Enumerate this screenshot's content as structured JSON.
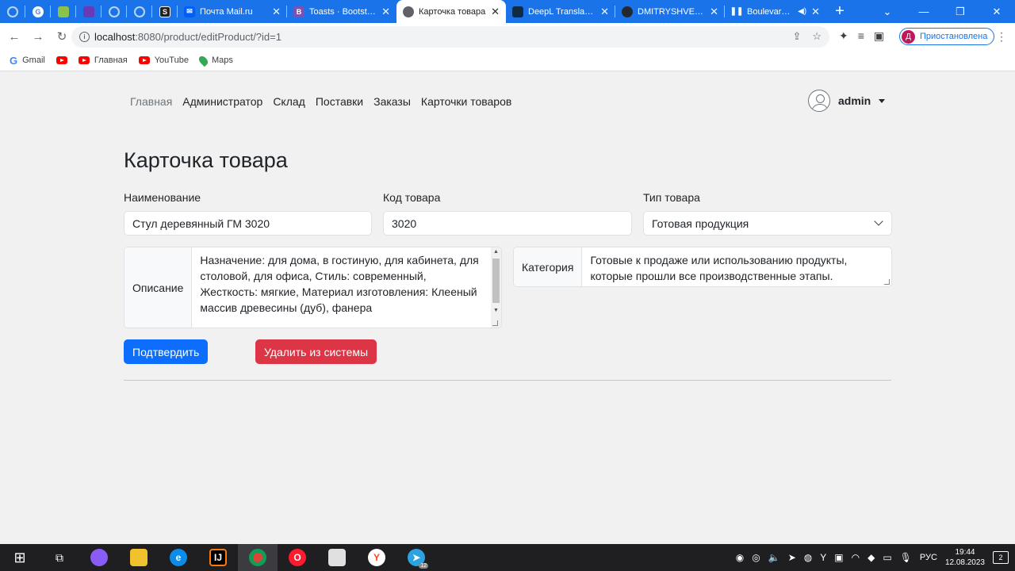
{
  "browser": {
    "tabs": [
      {
        "title": "Почта Mail.ru",
        "favicon": "mail-icon",
        "color": "#005ff9"
      },
      {
        "title": "Toasts · Bootstrap v",
        "favicon": "bootstrap-icon",
        "color": "#7952b3"
      },
      {
        "title": "Карточка товара",
        "favicon": "globe-icon",
        "color": "#5f6368"
      },
      {
        "title": "DeepL Translate – С",
        "favicon": "deepl-icon",
        "color": "#0f2b46"
      },
      {
        "title": "DMITRYSHVED/W",
        "favicon": "github-icon",
        "color": "#24292f"
      },
      {
        "title": "Boulevard Dep",
        "favicon": "pause-icon",
        "color": "#1a73e8"
      }
    ],
    "url_host": "localhost",
    "url_path": ":8080/product/editProduct/?id=1",
    "profile_initial": "Д",
    "profile_label": "Приостановлена",
    "bookmarks": [
      {
        "label": "Gmail",
        "icon": "google-icon"
      },
      {
        "label": "",
        "icon": "youtube-icon"
      },
      {
        "label": "Главная",
        "icon": "youtube-icon"
      },
      {
        "label": "YouTube",
        "icon": "youtube-icon"
      },
      {
        "label": "Maps",
        "icon": "maps-icon"
      }
    ]
  },
  "nav": {
    "items": [
      "Главная",
      "Администратор",
      "Склад",
      "Поставки",
      "Заказы",
      "Карточки товаров"
    ],
    "user": "admin"
  },
  "page": {
    "title": "Карточка товара",
    "name_label": "Наименование",
    "name_value": "Стул деревянный ГМ 3020",
    "code_label": "Код товара",
    "code_value": "3020",
    "type_label": "Тип товара",
    "type_value": "Готовая продукция",
    "description_label": "Описание",
    "description_value": "Назначение: для дома, в гостиную, для кабинета, для столовой, для офиса, Стиль: современный, Жесткость: мягкие, Материал изготовления: Клееный массив древесины (дуб), фанера",
    "category_label": "Категория",
    "category_value": "Готовые к продаже или использованию продукты, которые прошли все производственные этапы.",
    "confirm_button": "Подтвердить",
    "delete_button": "Удалить из системы"
  },
  "taskbar": {
    "lang": "РУС",
    "time": "19:44",
    "date": "12.08.2023",
    "notifications": "2",
    "telegram_badge": "12"
  }
}
